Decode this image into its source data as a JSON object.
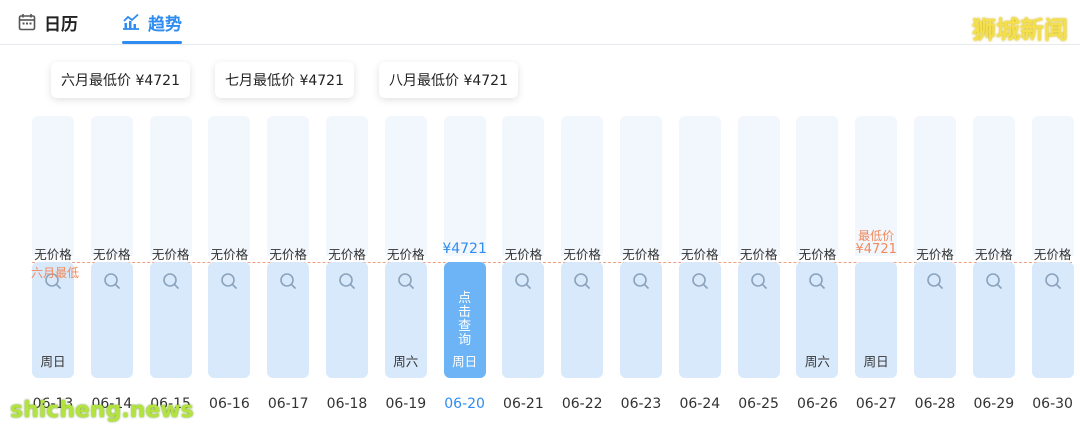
{
  "tabs": [
    {
      "label": "日历",
      "icon": "calendar-icon"
    },
    {
      "label": "趋势",
      "icon": "trend-chart-icon"
    }
  ],
  "watermarks": {
    "top": "狮城新闻",
    "bottom": "shicheng.news"
  },
  "month_cards": [
    {
      "label": "六月最低价 ¥4721"
    },
    {
      "label": "七月最低价 ¥4721"
    },
    {
      "label": "八月最低价 ¥4721"
    }
  ],
  "june_low_label": "六月最低",
  "no_price": "无价格",
  "lowest_label": "最低价",
  "query_label": "点击查询",
  "days": [
    {
      "date": "06-13",
      "price": "无价格",
      "weekday": "周日"
    },
    {
      "date": "06-14",
      "price": "无价格",
      "weekday": ""
    },
    {
      "date": "06-15",
      "price": "无价格",
      "weekday": ""
    },
    {
      "date": "06-16",
      "price": "无价格",
      "weekday": ""
    },
    {
      "date": "06-17",
      "price": "无价格",
      "weekday": ""
    },
    {
      "date": "06-18",
      "price": "无价格",
      "weekday": ""
    },
    {
      "date": "06-19",
      "price": "无价格",
      "weekday": "周六"
    },
    {
      "date": "06-20",
      "price": "¥4721",
      "weekday": "周日",
      "state": "active"
    },
    {
      "date": "06-21",
      "price": "无价格",
      "weekday": ""
    },
    {
      "date": "06-22",
      "price": "无价格",
      "weekday": ""
    },
    {
      "date": "06-23",
      "price": "无价格",
      "weekday": ""
    },
    {
      "date": "06-24",
      "price": "无价格",
      "weekday": ""
    },
    {
      "date": "06-25",
      "price": "无价格",
      "weekday": ""
    },
    {
      "date": "06-26",
      "price": "无价格",
      "weekday": "周六"
    },
    {
      "date": "06-27",
      "price": "¥4721",
      "weekday": "周日",
      "state": "lowest"
    },
    {
      "date": "06-28",
      "price": "无价格",
      "weekday": ""
    },
    {
      "date": "06-29",
      "price": "无价格",
      "weekday": ""
    },
    {
      "date": "06-30",
      "price": "无价格",
      "weekday": ""
    }
  ],
  "colors": {
    "accent": "#2f8cf0",
    "lowest": "#f08a5d",
    "bar_light": "#f2f7fd",
    "bar_mid": "#d8e9fb",
    "bar_active": "#6db4f7"
  }
}
